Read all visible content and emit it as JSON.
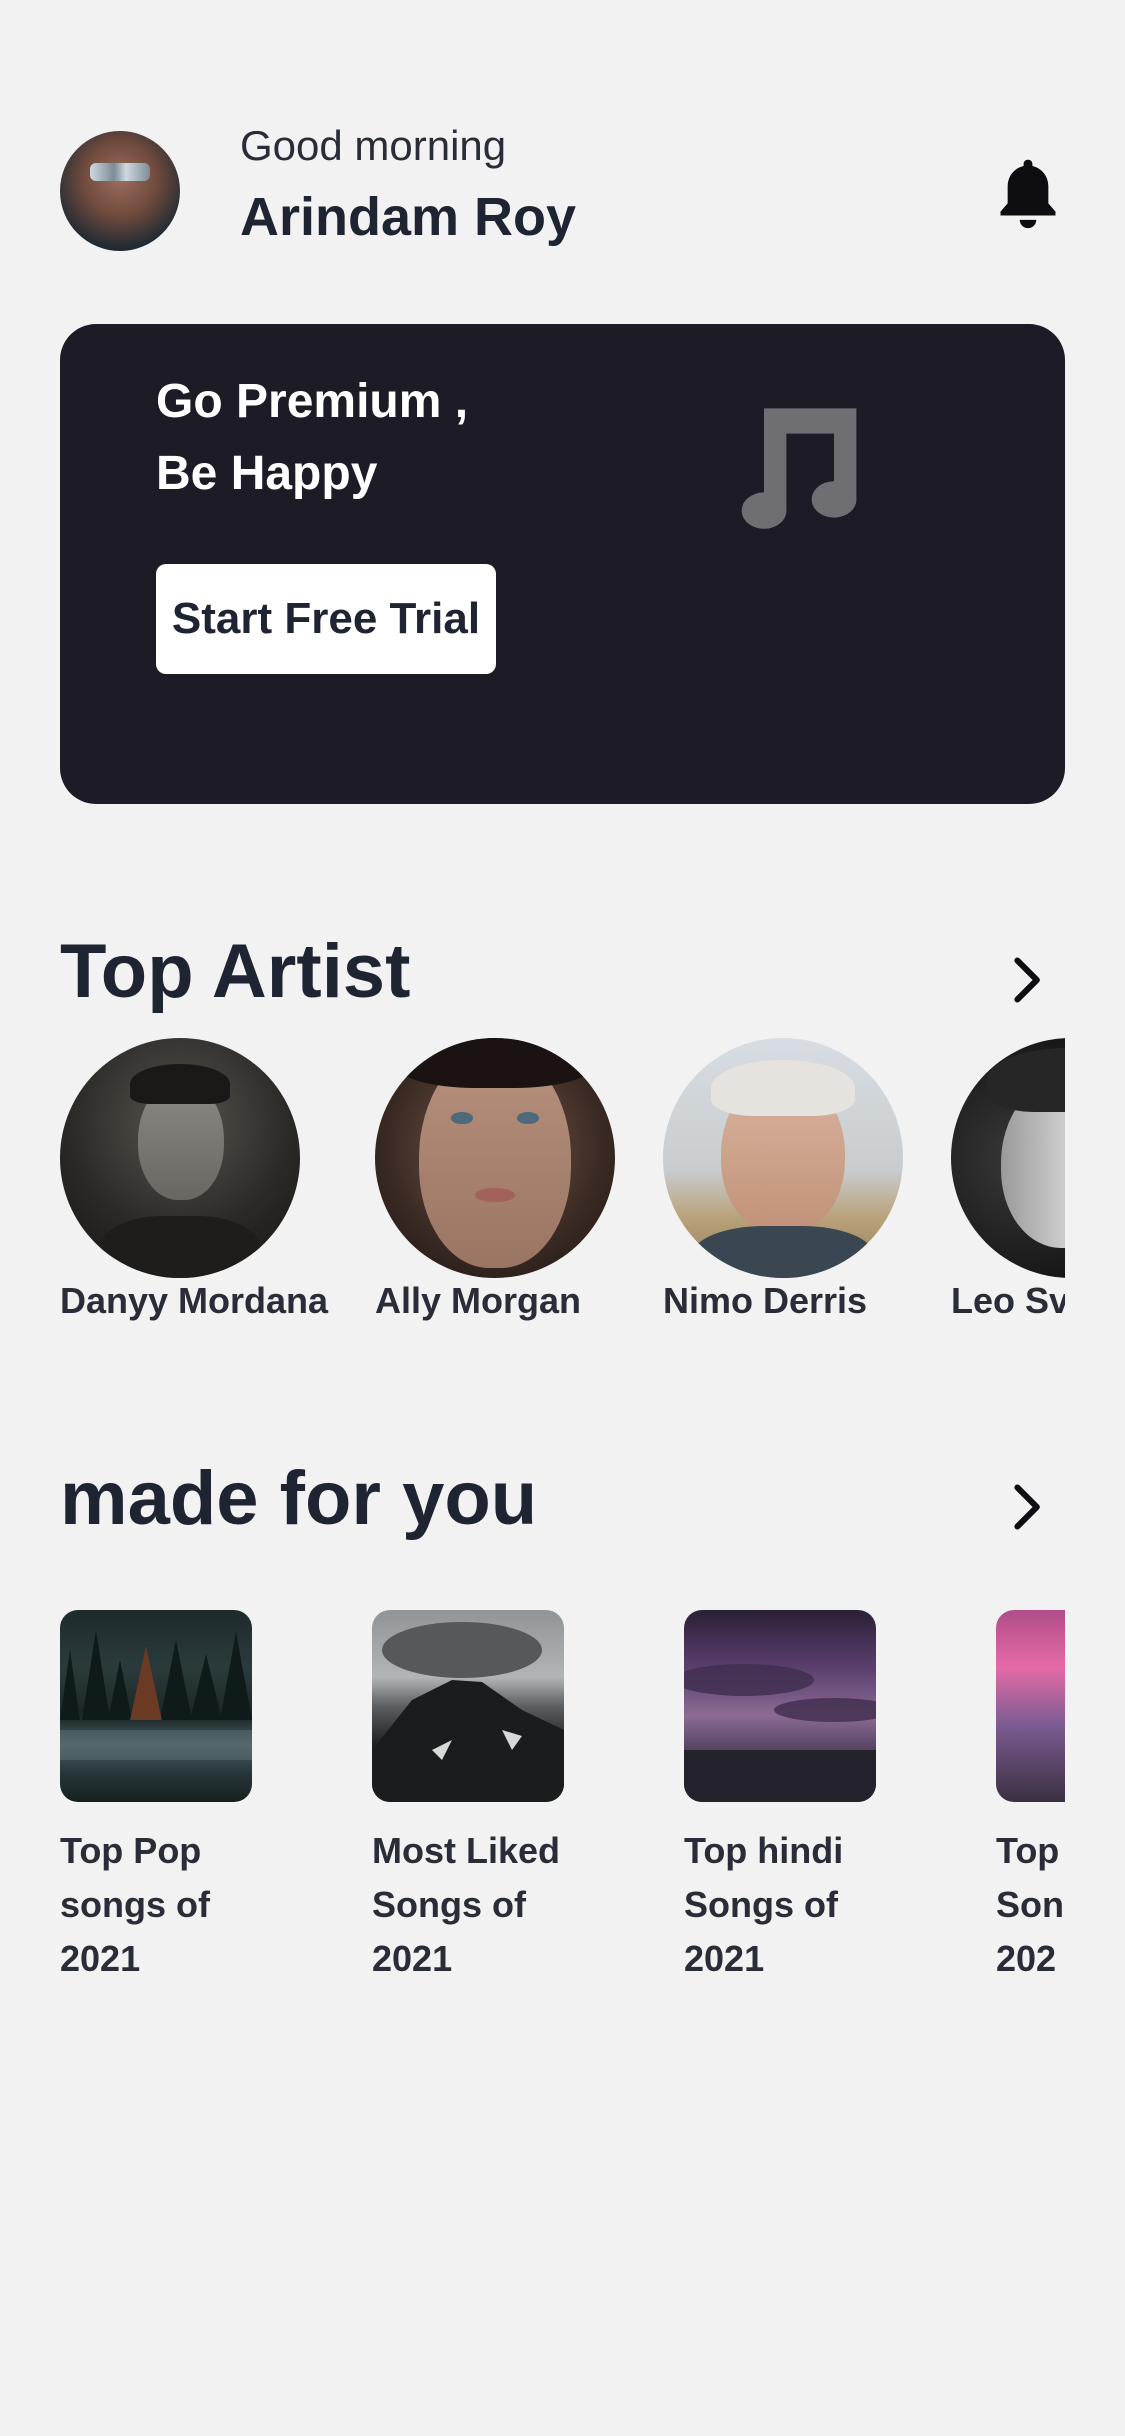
{
  "header": {
    "greeting": "Good morning",
    "username": "Arindam Roy",
    "icons": {
      "avatar": "user-avatar",
      "notification": "bell-icon"
    }
  },
  "banner": {
    "line1": "Go Premium ,",
    "line2": "Be Happy",
    "button_label": "Start Free Trial",
    "icon": "music-note-icon",
    "background": "#1c1b26"
  },
  "top_artist": {
    "title": "Top Artist",
    "icon": "chevron-right-icon",
    "artists": [
      {
        "name": "Danyy Mordana"
      },
      {
        "name": "Ally Morgan"
      },
      {
        "name": "Nimo Derris"
      },
      {
        "name": "Leo Sv"
      }
    ]
  },
  "made_for_you": {
    "title": "made for you",
    "icon": "chevron-right-icon",
    "playlists": [
      {
        "label": "Top Pop\nsongs of 2021"
      },
      {
        "label": "Most Liked\nSongs of\n2021"
      },
      {
        "label": "Top hindi\nSongs of\n2021"
      },
      {
        "label": "Top\nSon\n202"
      }
    ]
  },
  "colors": {
    "background": "#f2f2f2",
    "text": "#1f2433",
    "banner": "#1c1b26"
  }
}
